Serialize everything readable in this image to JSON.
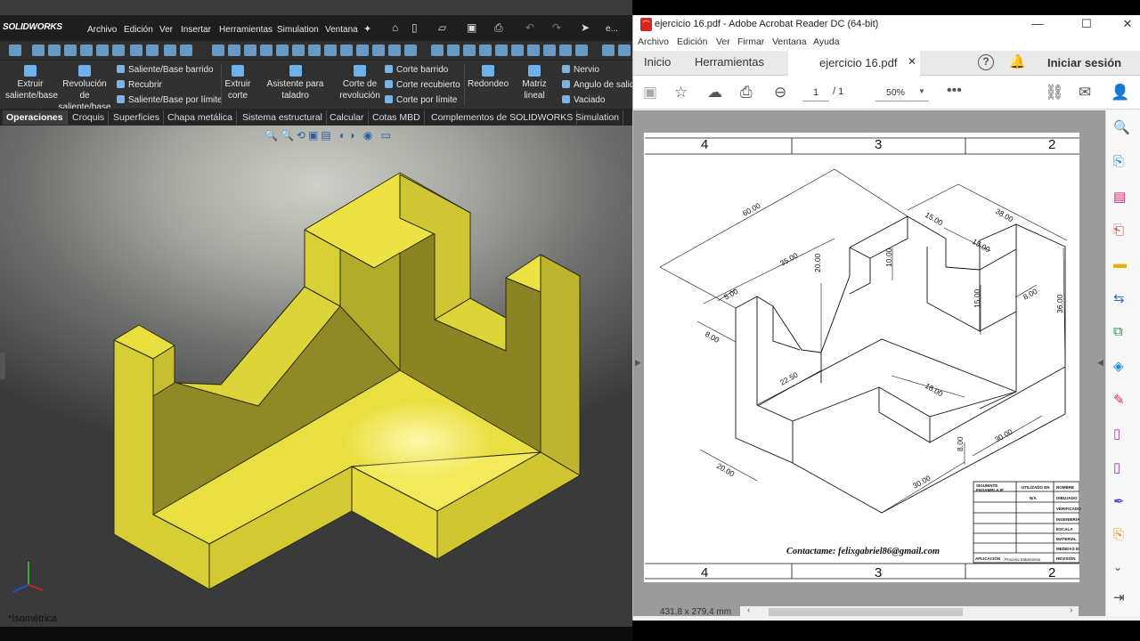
{
  "solidworks": {
    "logo": "SOLIDWORKS",
    "menu": [
      "Archivo",
      "Edición",
      "Ver",
      "Insertar",
      "Herramientas",
      "Simulation",
      "Ventana"
    ],
    "ribbon": {
      "extrude_boss": "Extruir saliente/base",
      "revolve_boss": "Revolución de saliente/base",
      "swept_boss": "Saliente/Base barrido",
      "wrap": "Recubrir",
      "boundary_boss": "Saliente/Base por límite",
      "extrude_cut": "Extruir corte",
      "hole_wizard": "Asistente para taladro",
      "revolve_cut": "Corte de revolución",
      "swept_cut": "Corte barrido",
      "lofted_cut": "Corte recubierto",
      "boundary_cut": "Corte por límite",
      "fillet": "Redondeo",
      "linear_pattern": "Matriz lineal",
      "rib": "Nervio",
      "draft": "Ángulo de salid",
      "shell": "Vaciado"
    },
    "tabs": [
      "Operaciones",
      "Croquis",
      "Superficies",
      "Chapa metálica",
      "Sistema estructural",
      "Calcular",
      "Cotas MBD",
      "Complementos de SOLIDWORKS",
      "Simulation"
    ],
    "active_tab": "Operaciones",
    "view_label": "*Isométrica",
    "model_color": "#e6dc3a"
  },
  "acrobat": {
    "window_title": "ejercicio 16.pdf - Adobe Acrobat Reader DC (64-bit)",
    "menu": [
      "Archivo",
      "Edición",
      "Ver",
      "Firmar",
      "Ventana",
      "Ayuda"
    ],
    "tabs": {
      "home": "Inicio",
      "tools": "Herramientas",
      "document": "ejercicio 16.pdf"
    },
    "sign_in": "Iniciar sesión",
    "page_current": "1",
    "page_total": "/ 1",
    "zoom": "50%",
    "page_size": "431,8 x 279,4 mm",
    "accent": "#1473e6",
    "drawing": {
      "zones_top": [
        "4",
        "3",
        "2"
      ],
      "zones_bottom": [
        "4",
        "3",
        "2"
      ],
      "dimensions": [
        "60.00",
        "35.00",
        "15.00",
        "38.00",
        "15.00",
        "20.00",
        "10.00",
        "5.00",
        "8.00",
        "15.00",
        "8.00",
        "36.00",
        "22.50",
        "18.00",
        "20.00",
        "8.00",
        "30.00",
        "30.00"
      ],
      "contact": "Contactame: felixgabriel86@gmail.com",
      "title_block": {
        "r0": [
          "SIGUIENTE ENSAMBLAJE",
          "UTILIZADO EN",
          "NOMBRE"
        ],
        "labels": [
          "DIBUJADO",
          "VERIFICADO",
          "INGENIERÍA",
          "ESCALA",
          "MATERIAL",
          "MEDIDAS EN",
          "REVISIÓN"
        ],
        "na": "N/A",
        "aplicacion": "APLICACIÓN",
        "proceso": "Proceso tratamiento"
      }
    }
  }
}
